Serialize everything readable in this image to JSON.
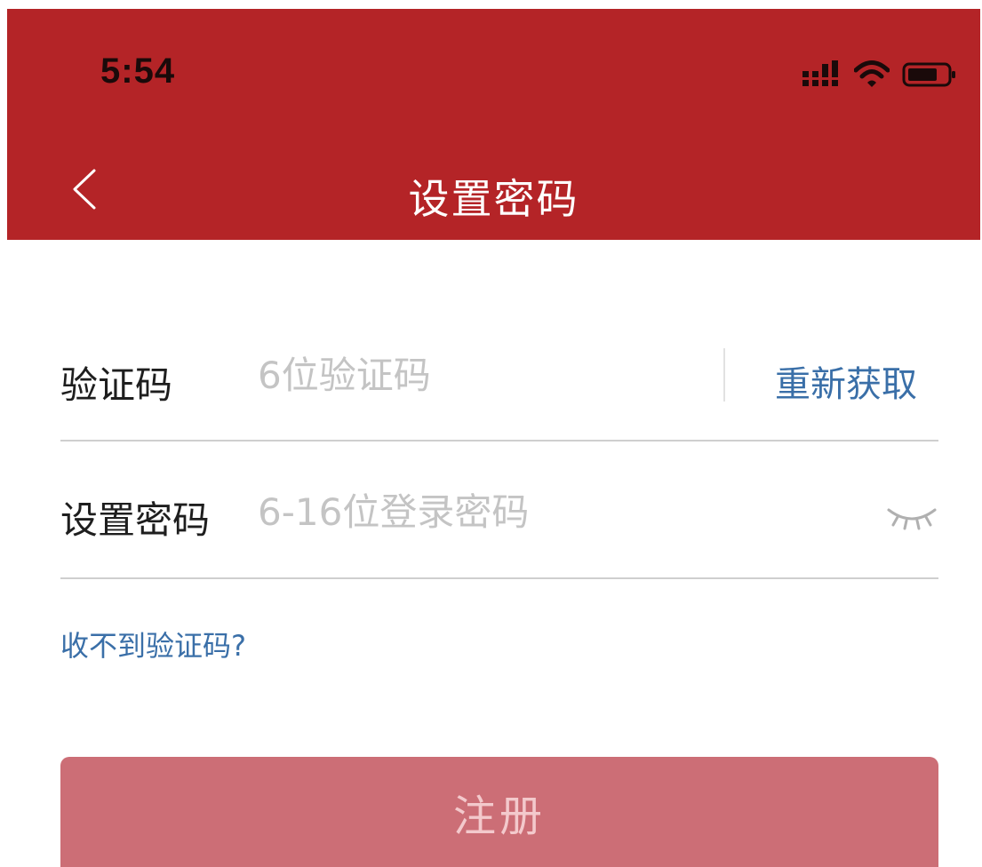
{
  "status_bar": {
    "time": "5:54",
    "icons": [
      "signal-icon",
      "wifi-icon",
      "battery-icon"
    ]
  },
  "nav": {
    "title": "设置密码",
    "back_icon": "chevron-left-icon"
  },
  "form": {
    "code": {
      "label": "验证码",
      "placeholder": "6位验证码",
      "value": "",
      "resend_label": "重新获取"
    },
    "password": {
      "label": "设置密码",
      "placeholder": "6-16位登录密码",
      "value": "",
      "toggle_icon": "eye-closed-icon"
    },
    "help_link": "收不到验证码?",
    "submit_label": "注册"
  },
  "colors": {
    "header_bg": "#b42427",
    "link": "#3a6fa8",
    "button_disabled_bg": "#cc6e76",
    "button_disabled_text": "#f3c9cc",
    "placeholder": "#c4c4c4"
  }
}
